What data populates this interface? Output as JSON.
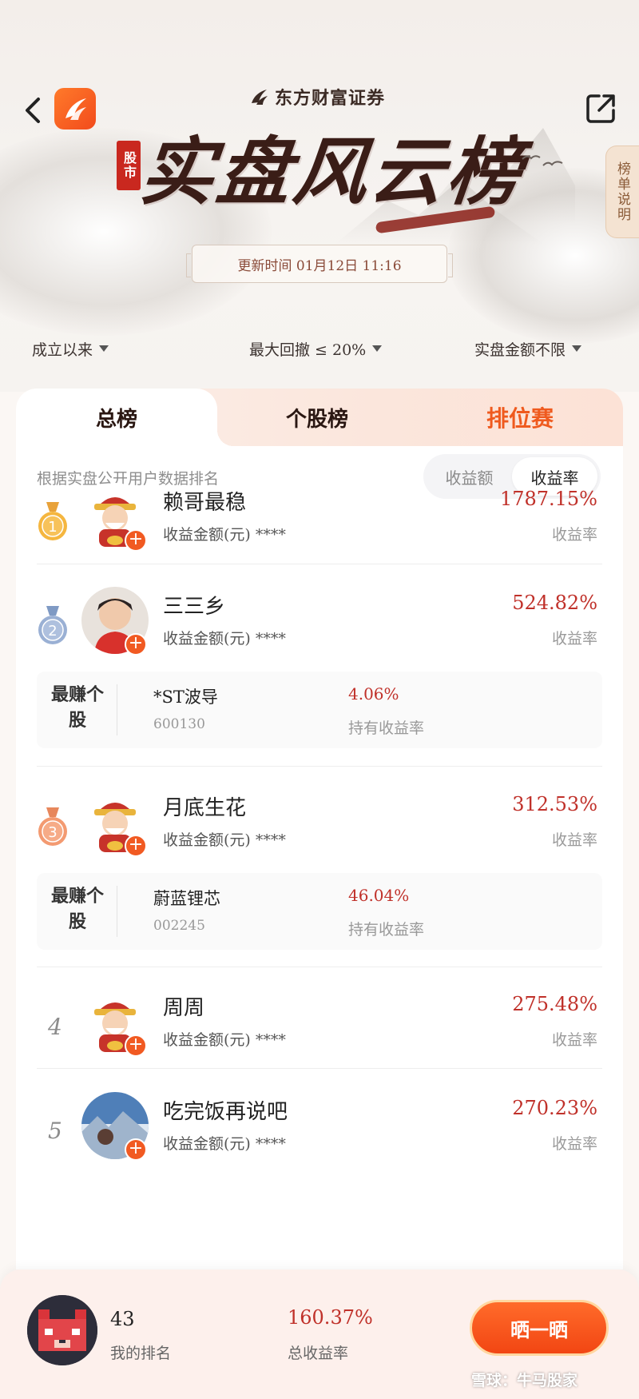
{
  "header": {
    "brand_name": "东方财富证券",
    "seal_text": "股市",
    "title": "实盘风云榜",
    "rules_tab": "榜单说明",
    "update_time": "更新时间 01月12日 11:16"
  },
  "filters": [
    {
      "label": "成立以来"
    },
    {
      "label": "最大回撤 ≤ 20%"
    },
    {
      "label": "实盘金额不限"
    }
  ],
  "tabs": [
    {
      "label": "总榜",
      "active": true
    },
    {
      "label": "个股榜",
      "active": false
    },
    {
      "label": "排位赛",
      "active": false
    }
  ],
  "list": {
    "subtitle": "根据实盘公开用户数据排名",
    "toggle": [
      {
        "label": "收益额",
        "active": false
      },
      {
        "label": "收益率",
        "active": true
      }
    ],
    "rows": [
      {
        "rank": "1",
        "medal": "gold",
        "avatar": "caishen-avatar",
        "name": "赖哥最稳",
        "amount_label": "收益金额(元) ****",
        "rate": "1787.15%",
        "rate_label": "收益率"
      },
      {
        "rank": "2",
        "medal": "silver",
        "avatar": "child-photo-avatar",
        "name": "三三乡",
        "amount_label": "收益金额(元) ****",
        "rate": "524.82%",
        "rate_label": "收益率",
        "best_stock": {
          "tag": "最赚个股",
          "name": "*ST波导",
          "code": "600130",
          "rate": "4.06%",
          "rate_label": "持有收益率"
        }
      },
      {
        "rank": "3",
        "medal": "bronze",
        "avatar": "caishen-avatar",
        "name": "月底生花",
        "amount_label": "收益金额(元) ****",
        "rate": "312.53%",
        "rate_label": "收益率",
        "best_stock": {
          "tag": "最赚个股",
          "name": "蔚蓝锂芯",
          "code": "002245",
          "rate": "46.04%",
          "rate_label": "持有收益率"
        }
      },
      {
        "rank": "4",
        "medal": "none",
        "avatar": "caishen-avatar",
        "name": "周周",
        "amount_label": "收益金额(元) ****",
        "rate": "275.48%",
        "rate_label": "收益率"
      },
      {
        "rank": "5",
        "medal": "none",
        "avatar": "landscape-photo-avatar",
        "name": "吃完饭再说吧",
        "amount_label": "收益金额(元) ****",
        "rate": "270.23%",
        "rate_label": "收益率"
      }
    ]
  },
  "footer": {
    "my_rank": "43",
    "my_rank_label": "我的排名",
    "total_rate": "160.37%",
    "total_rate_label": "总收益率",
    "cta": "晒一晒",
    "watermark": "雪球：牛马股家"
  },
  "colors": {
    "accent": "#f15a22",
    "rate_red": "#c0312a",
    "title_dark": "#3a1d17"
  }
}
